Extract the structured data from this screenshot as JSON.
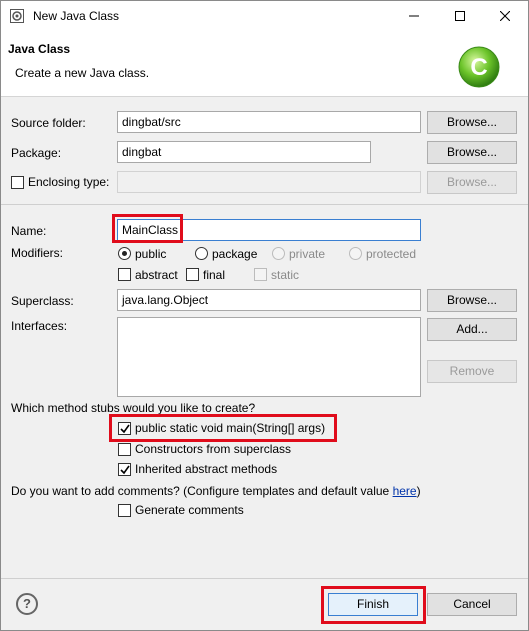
{
  "window": {
    "title": "New Java Class",
    "controls": {
      "minimize": "minimize",
      "maximize": "maximize",
      "close": "close"
    }
  },
  "header": {
    "title": "Java Class",
    "description": "Create a new Java class.",
    "icon": "java-class-logo-icon",
    "icon_letter": "C"
  },
  "source_folder": {
    "label": "Source folder:",
    "value": "dingbat/src",
    "browse_label": "Browse..."
  },
  "package": {
    "label": "Package:",
    "value": "dingbat",
    "browse_label": "Browse..."
  },
  "enclosing_type": {
    "label": "Enclosing type:",
    "value": "",
    "checked": false,
    "browse_label": "Browse..."
  },
  "name": {
    "label": "Name:",
    "value": "MainClass"
  },
  "modifiers": {
    "label": "Modifiers:",
    "access": [
      {
        "label": "public",
        "selected": true,
        "enabled": true
      },
      {
        "label": "package",
        "selected": false,
        "enabled": true
      },
      {
        "label": "private",
        "selected": false,
        "enabled": false
      },
      {
        "label": "protected",
        "selected": false,
        "enabled": false
      }
    ],
    "flags": [
      {
        "label": "abstract",
        "checked": false,
        "enabled": true
      },
      {
        "label": "final",
        "checked": false,
        "enabled": true
      },
      {
        "label": "static",
        "checked": false,
        "enabled": false
      }
    ]
  },
  "superclass": {
    "label": "Superclass:",
    "value": "java.lang.Object",
    "browse_label": "Browse..."
  },
  "interfaces": {
    "label": "Interfaces:",
    "add_label": "Add...",
    "remove_label": "Remove"
  },
  "method_stubs": {
    "question": "Which method stubs would you like to create?",
    "options": [
      {
        "label": "public static void main(String[] args)",
        "checked": true
      },
      {
        "label": "Constructors from superclass",
        "checked": false
      },
      {
        "label": "Inherited abstract methods",
        "checked": true
      }
    ]
  },
  "comments": {
    "question": "Do you want to add comments? (Configure templates and default value ",
    "link": "here",
    "question_end": ")",
    "option": {
      "label": "Generate comments",
      "checked": false
    }
  },
  "footer": {
    "help": "?",
    "finish_label": "Finish",
    "cancel_label": "Cancel"
  },
  "colors": {
    "highlight": "#e00c1b",
    "link": "#0033aa",
    "focus_border": "#3a7fd1"
  }
}
